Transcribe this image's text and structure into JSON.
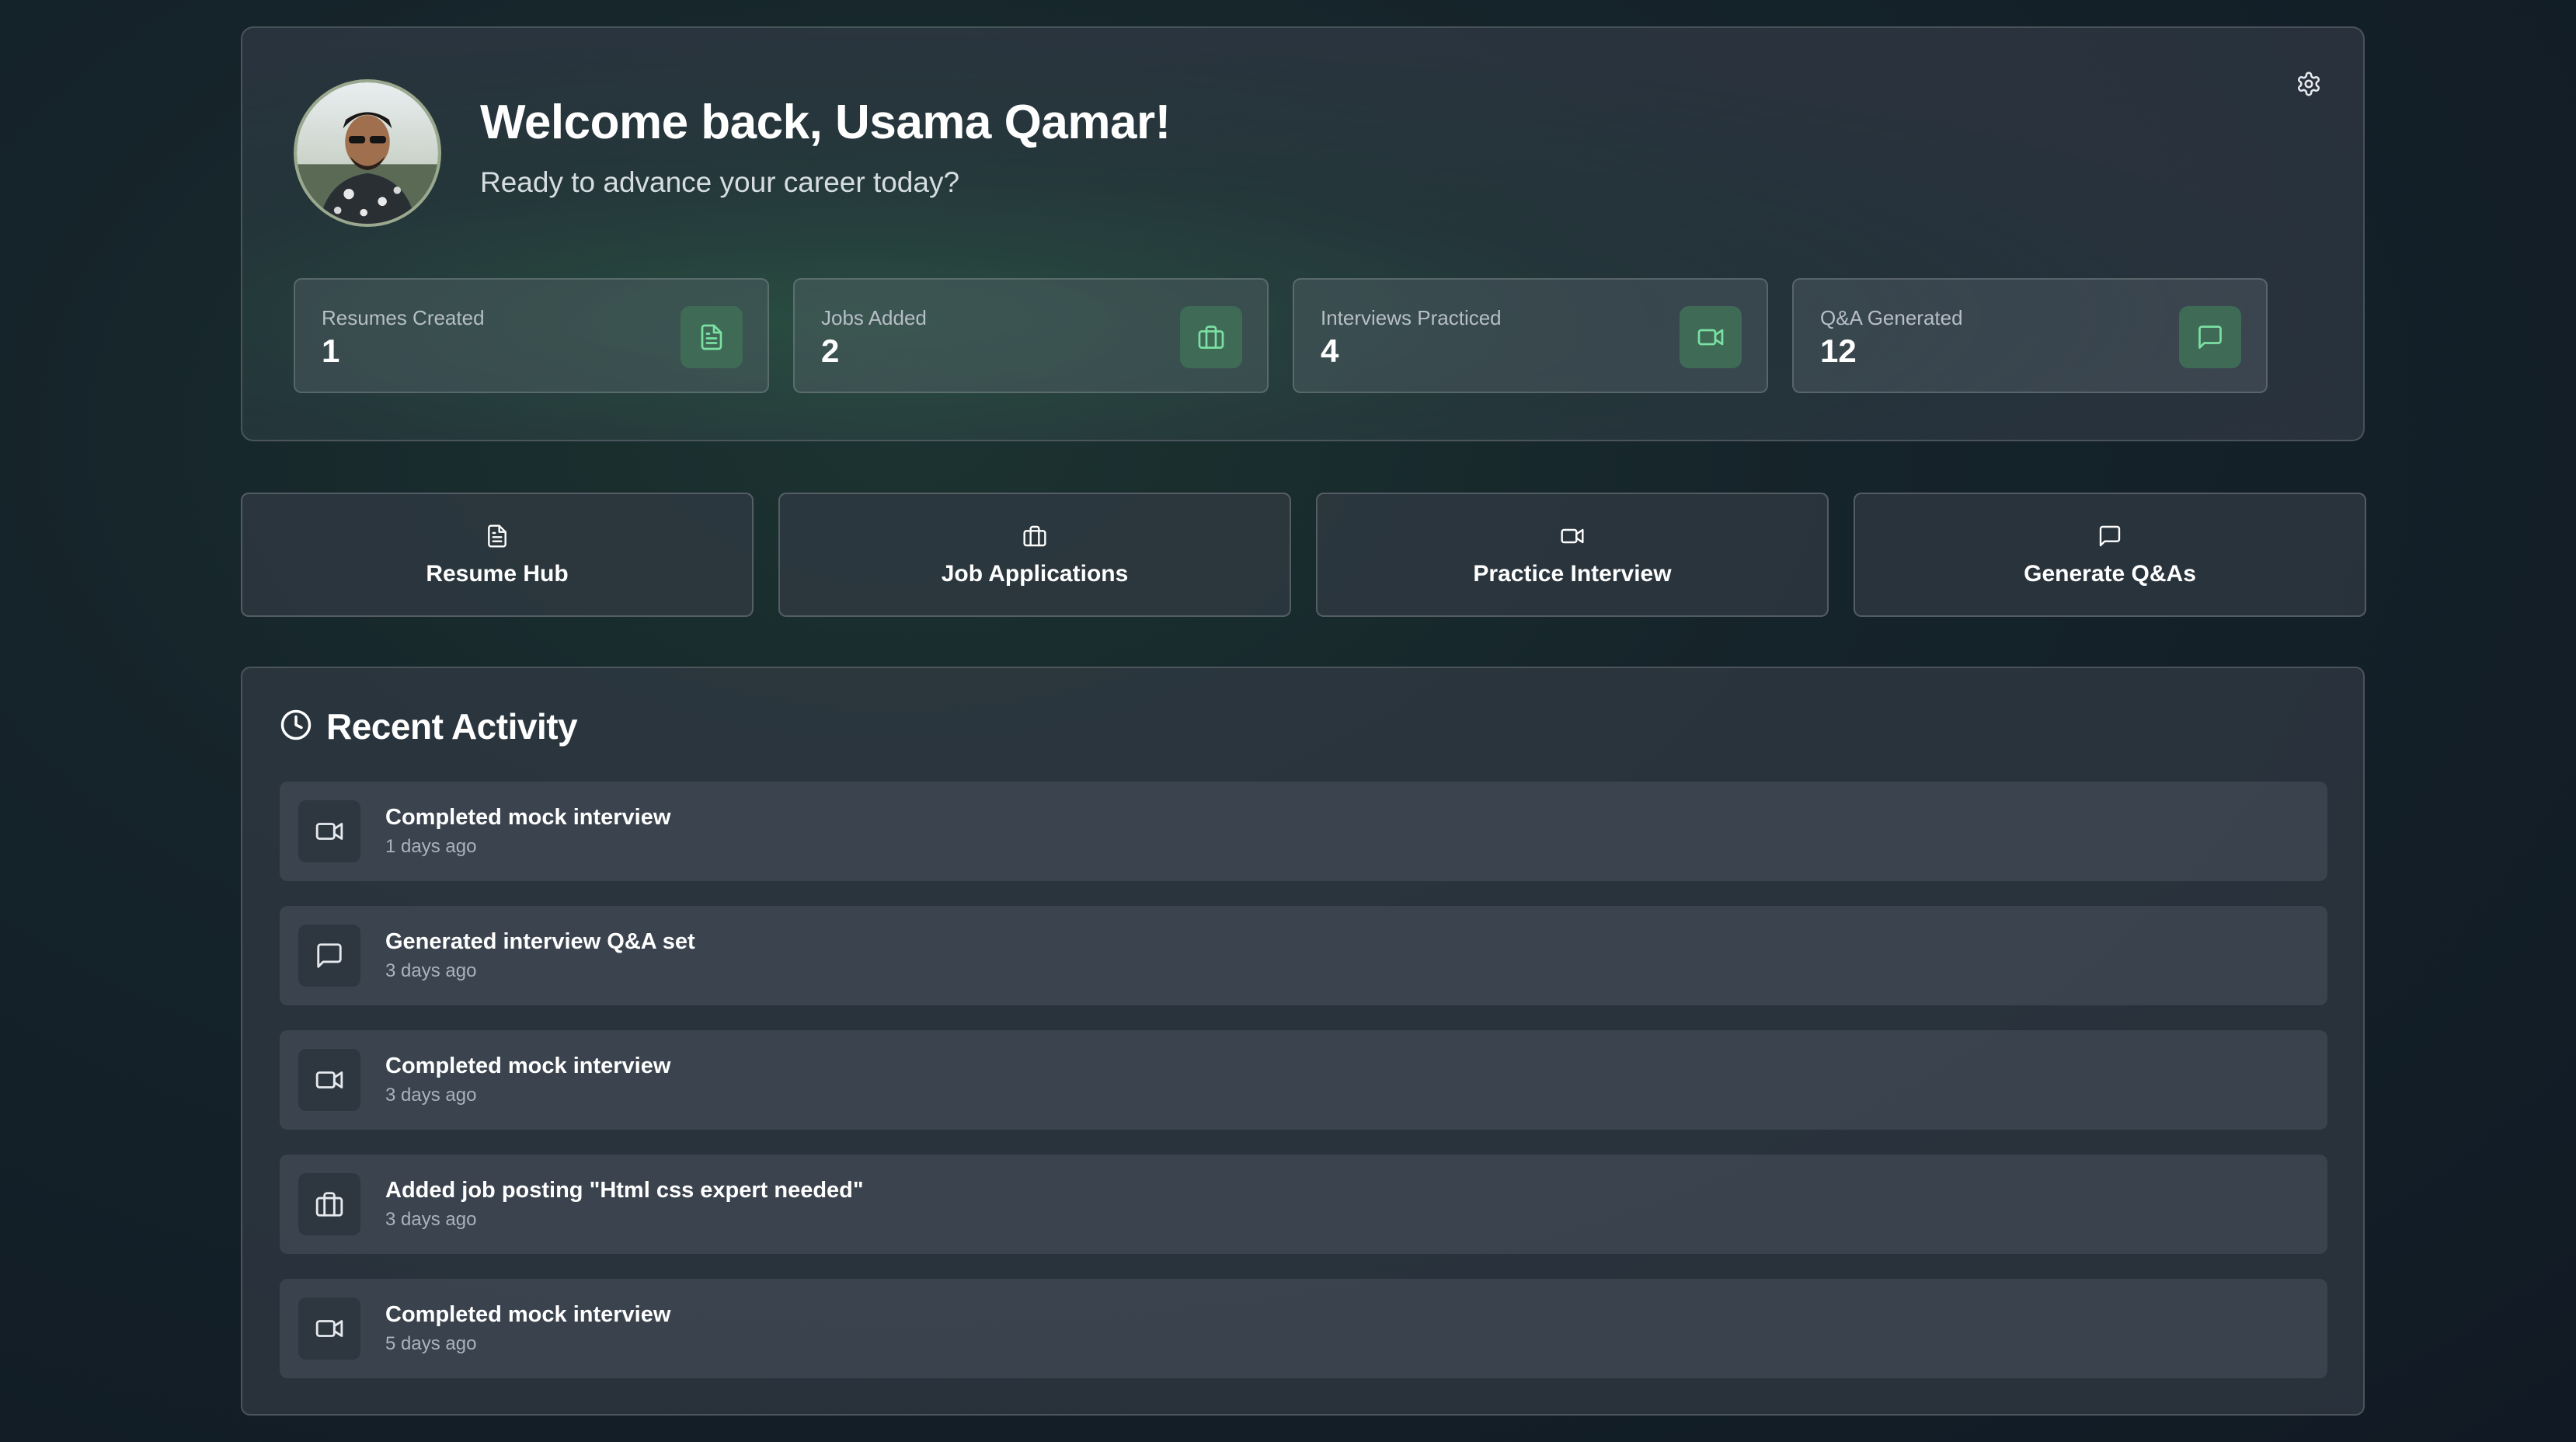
{
  "header": {
    "welcome": "Welcome back, Usama Qamar!",
    "subtitle": "Ready to advance your career today?",
    "avatar_icon": "user-avatar",
    "settings_icon": "gear-icon"
  },
  "stats": [
    {
      "label": "Resumes Created",
      "value": "1",
      "icon": "file-text-icon"
    },
    {
      "label": "Jobs Added",
      "value": "2",
      "icon": "briefcase-icon"
    },
    {
      "label": "Interviews Practiced",
      "value": "4",
      "icon": "video-icon"
    },
    {
      "label": "Q&A Generated",
      "value": "12",
      "icon": "message-square-icon"
    }
  ],
  "actions": [
    {
      "label": "Resume Hub",
      "icon": "file-text-icon"
    },
    {
      "label": "Job Applications",
      "icon": "briefcase-icon"
    },
    {
      "label": "Practice Interview",
      "icon": "video-icon"
    },
    {
      "label": "Generate Q&As",
      "icon": "message-square-icon"
    }
  ],
  "recent": {
    "title": "Recent Activity",
    "icon": "clock-icon",
    "items": [
      {
        "title": "Completed mock interview",
        "time": "1 days ago",
        "icon": "video-icon"
      },
      {
        "title": "Generated interview Q&A set",
        "time": "3 days ago",
        "icon": "message-square-icon"
      },
      {
        "title": "Completed mock interview",
        "time": "3 days ago",
        "icon": "video-icon"
      },
      {
        "title": "Added job posting \"Html css expert needed\"",
        "time": "3 days ago",
        "icon": "briefcase-icon"
      },
      {
        "title": "Completed mock interview",
        "time": "5 days ago",
        "icon": "video-icon"
      }
    ]
  },
  "colors": {
    "accent": "#6fd69a",
    "accent_bg": "#3e6a56",
    "text": "#ffffff",
    "muted": "#aab3bb"
  }
}
